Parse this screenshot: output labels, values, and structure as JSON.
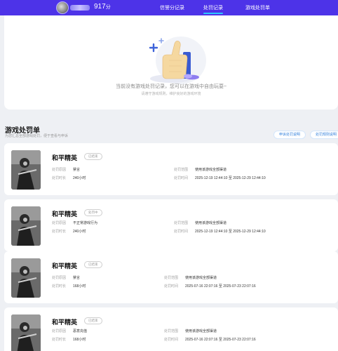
{
  "header": {
    "score": "917",
    "score_unit": "分",
    "nav": [
      "信誉分记录",
      "处罚记录",
      "游戏处罚单"
    ]
  },
  "empty_state": {
    "message": "当前没有游戏处罚记录，您可以在游戏中自由玩耍~",
    "sub_message": "请遵守游戏规则，维护良好的游戏环境"
  },
  "section": {
    "title": "游戏处罚单",
    "subtitle": "为您汇总全部游戏处罚，便于查看与申诉",
    "buttons": [
      "申诉处罚说明",
      "处罚规则说明"
    ]
  },
  "labels": {
    "reason": "处罚原因",
    "duration": "处罚时长",
    "scope": "处罚范围",
    "time": "处罚时间"
  },
  "penalties": [
    {
      "game": "和平精英",
      "status": "已结束",
      "reason": "禁言",
      "duration": "240小时",
      "scope": "使用该游戏全部渠道",
      "time": "2025-12-19 12:44:10 至 2025-12-29 12:44:10"
    },
    {
      "game": "和平精英",
      "status": "处罚中",
      "reason": "不正常游戏行为",
      "duration": "240小时",
      "scope": "使用该游戏全部渠道",
      "time": "2025-12-19 12:44:10 至 2025-12-29 12:44:10"
    },
    {
      "game": "和平精英",
      "status": "已结束",
      "reason": "禁言",
      "duration": "168小时",
      "scope": "使用该游戏全部渠道",
      "time": "2025-07-16 22:07:16 至 2025-07-23 22:07:16"
    },
    {
      "game": "和平精英",
      "status": "已结束",
      "reason": "恶意充值",
      "duration": "168小时",
      "scope": "使用该游戏全部渠道",
      "time": "2025-07-16 22:07:16 至 2025-07-23 22:07:16"
    }
  ]
}
